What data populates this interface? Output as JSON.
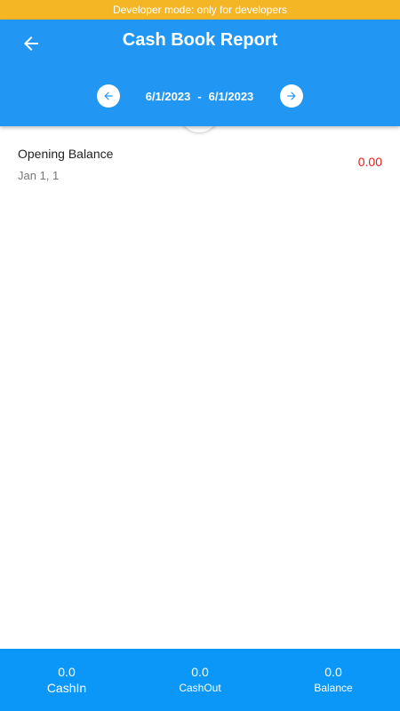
{
  "banner": {
    "text": "Developer mode: only for developers"
  },
  "header": {
    "title": "Cash Book Report",
    "back_icon": "arrow-left-icon",
    "date_from": "6/1/2023",
    "date_separator": "-",
    "date_to": "6/1/2023",
    "prev_icon": "arrow-left-icon",
    "next_icon": "arrow-right-icon"
  },
  "entries": [
    {
      "label": "Opening Balance",
      "date": "Jan 1, 1",
      "amount": "0.00"
    }
  ],
  "summary": {
    "cash_in": {
      "value": "0.0",
      "label": "CashIn"
    },
    "cash_out": {
      "value": "0.0",
      "label": "CashOut"
    },
    "balance": {
      "value": "0.0",
      "label": "Balance"
    }
  },
  "colors": {
    "banner": "#f5b626",
    "app_bar": "#2196f3",
    "bottom_bar": "#0a97f7",
    "negative_amount": "#e02020"
  }
}
